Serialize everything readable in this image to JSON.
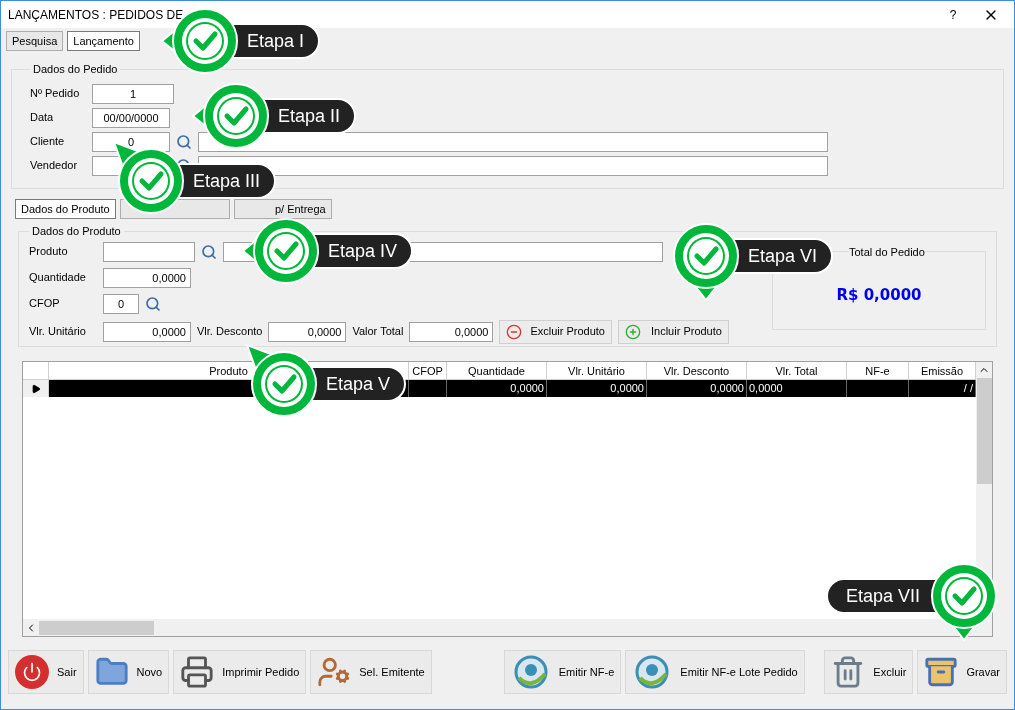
{
  "window": {
    "title": "LANÇAMENTOS : PEDIDOS DE",
    "help": "?"
  },
  "tabs": [
    {
      "label": "Pesquisa",
      "selected": false
    },
    {
      "label": "Lançamento",
      "selected": true
    }
  ],
  "order": {
    "legend": "Dados do Pedido",
    "number_label": "Nº Pedido",
    "number": "1",
    "date_label": "Data",
    "date": "00/00/0000",
    "client_label": "Cliente",
    "client": "0",
    "seller_label": "Vendedor"
  },
  "product_tabs": [
    {
      "label": "Dados do Produto",
      "selected": true
    },
    {
      "selected": false
    },
    {
      "label": "p/ Entrega",
      "selected": false
    }
  ],
  "product": {
    "legend": "Dados do Produto",
    "product_label": "Produto",
    "quantity_label": "Quantidade",
    "quantity": "0,0000",
    "cfop_label": "CFOP",
    "cfop": "0",
    "unit_label": "Vlr. Unitário",
    "unit": "0,0000",
    "discount_label": "Vlr. Desconto",
    "discount": "0,0000",
    "total_label": "Valor Total",
    "total": "0,0000",
    "remove_button": "Excluir Produto",
    "add_button": "Incluir Produto"
  },
  "order_total": {
    "legend": "Total do Pedido",
    "value": "R$ 0,0000"
  },
  "table": {
    "columns": [
      "Produto",
      "CFOP",
      "Quantidade",
      "Vlr. Unitário",
      "Vlr. Desconto",
      "Vlr. Total",
      "NF-e",
      "Emissão"
    ],
    "rows": [
      {
        "selected": true,
        "cells": [
          "",
          "",
          "0,0000",
          "0,0000",
          "0,0000",
          "0,0000",
          "",
          "/ /"
        ]
      }
    ]
  },
  "buttons": [
    {
      "label": "Sair",
      "kind": "power"
    },
    {
      "label": "Novo",
      "kind": "folder"
    },
    {
      "label": "Imprimir Pedido",
      "kind": "printer"
    },
    {
      "label": "Sel. Emitente",
      "kind": "user"
    },
    {
      "label": "Emitir NF-e",
      "kind": "nfe"
    },
    {
      "label": "Emitir NF-e Lote Pedido",
      "kind": "nfe"
    },
    {
      "label": "Excluir",
      "kind": "trash"
    },
    {
      "label": "Gravar",
      "kind": "binder"
    }
  ],
  "callouts": [
    {
      "label": "Etapa I",
      "kind": "left"
    },
    {
      "label": "Etapa II",
      "kind": "left"
    },
    {
      "label": "Etapa III",
      "kind": "up"
    },
    {
      "label": "Etapa IV",
      "kind": "left"
    },
    {
      "label": "Etapa V",
      "kind": "up"
    },
    {
      "label": "Etapa VI",
      "kind": "down"
    },
    {
      "label": "Etapa VII",
      "kind": "down"
    }
  ]
}
